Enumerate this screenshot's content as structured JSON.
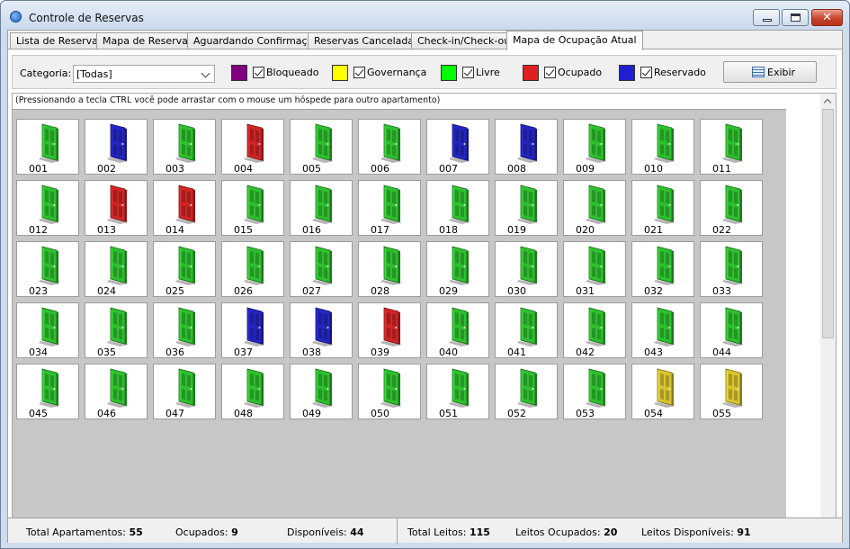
{
  "window": {
    "title": "Controle de Reservas",
    "close_glyph": "✕"
  },
  "tabs": [
    "Lista de Reservas",
    "Mapa de Reservas",
    "Aguardando Confirmação",
    "Reservas Canceladas",
    "Check-in/Check-out",
    "Mapa de Ocupação Atual"
  ],
  "active_tab": "Mapa de Ocupação Atual",
  "filter": {
    "category_label": "Categoria:",
    "category_value": "[Todas]",
    "legend": [
      {
        "label": "Bloqueado",
        "color": "#800080",
        "checked": true
      },
      {
        "label": "Governança",
        "color": "#ffff00",
        "checked": true
      },
      {
        "label": "Livre",
        "color": "#00ff00",
        "checked": true
      },
      {
        "label": "Ocupado",
        "color": "#e02020",
        "checked": true
      },
      {
        "label": "Reservado",
        "color": "#2020d0",
        "checked": true
      }
    ],
    "show_button": "Exibir"
  },
  "hint": "(Pressionando a tecla CTRL você pode arrastar com o mouse um hóspede para outro apartamento)",
  "room_colors": {
    "livre": "#2fbf2f",
    "reservado": "#2525c0",
    "ocupado": "#d02525",
    "governanca": "#d8c430"
  },
  "rooms": [
    {
      "n": "001",
      "s": "livre"
    },
    {
      "n": "002",
      "s": "reservado"
    },
    {
      "n": "003",
      "s": "livre"
    },
    {
      "n": "004",
      "s": "ocupado"
    },
    {
      "n": "005",
      "s": "livre"
    },
    {
      "n": "006",
      "s": "livre"
    },
    {
      "n": "007",
      "s": "reservado"
    },
    {
      "n": "008",
      "s": "reservado"
    },
    {
      "n": "009",
      "s": "livre"
    },
    {
      "n": "010",
      "s": "livre"
    },
    {
      "n": "011",
      "s": "livre"
    },
    {
      "n": "012",
      "s": "livre"
    },
    {
      "n": "013",
      "s": "ocupado"
    },
    {
      "n": "014",
      "s": "ocupado"
    },
    {
      "n": "015",
      "s": "livre"
    },
    {
      "n": "016",
      "s": "livre"
    },
    {
      "n": "017",
      "s": "livre"
    },
    {
      "n": "018",
      "s": "livre"
    },
    {
      "n": "019",
      "s": "livre"
    },
    {
      "n": "020",
      "s": "livre"
    },
    {
      "n": "021",
      "s": "livre"
    },
    {
      "n": "022",
      "s": "livre"
    },
    {
      "n": "023",
      "s": "livre"
    },
    {
      "n": "024",
      "s": "livre"
    },
    {
      "n": "025",
      "s": "livre"
    },
    {
      "n": "026",
      "s": "livre"
    },
    {
      "n": "027",
      "s": "livre"
    },
    {
      "n": "028",
      "s": "livre"
    },
    {
      "n": "029",
      "s": "livre"
    },
    {
      "n": "030",
      "s": "livre"
    },
    {
      "n": "031",
      "s": "livre"
    },
    {
      "n": "032",
      "s": "livre"
    },
    {
      "n": "033",
      "s": "livre"
    },
    {
      "n": "034",
      "s": "livre"
    },
    {
      "n": "035",
      "s": "livre"
    },
    {
      "n": "036",
      "s": "livre"
    },
    {
      "n": "037",
      "s": "reservado"
    },
    {
      "n": "038",
      "s": "reservado"
    },
    {
      "n": "039",
      "s": "ocupado"
    },
    {
      "n": "040",
      "s": "livre"
    },
    {
      "n": "041",
      "s": "livre"
    },
    {
      "n": "042",
      "s": "livre"
    },
    {
      "n": "043",
      "s": "livre"
    },
    {
      "n": "044",
      "s": "livre"
    },
    {
      "n": "045",
      "s": "livre"
    },
    {
      "n": "046",
      "s": "livre"
    },
    {
      "n": "047",
      "s": "livre"
    },
    {
      "n": "048",
      "s": "livre"
    },
    {
      "n": "049",
      "s": "livre"
    },
    {
      "n": "050",
      "s": "livre"
    },
    {
      "n": "051",
      "s": "livre"
    },
    {
      "n": "052",
      "s": "livre"
    },
    {
      "n": "053",
      "s": "livre"
    },
    {
      "n": "054",
      "s": "governanca"
    },
    {
      "n": "055",
      "s": "governanca"
    }
  ],
  "status": {
    "total_apartamentos_label": "Total Apartamentos:",
    "total_apartamentos": "55",
    "ocupados_label": "Ocupados:",
    "ocupados": "9",
    "disponiveis_label": "Disponíveis:",
    "disponiveis": "44",
    "total_leitos_label": "Total Leitos:",
    "total_leitos": "115",
    "leitos_ocupados_label": "Leitos Ocupados:",
    "leitos_ocupados": "20",
    "leitos_disponiveis_label": "Leitos Disponíveis:",
    "leitos_disponiveis": "91"
  }
}
